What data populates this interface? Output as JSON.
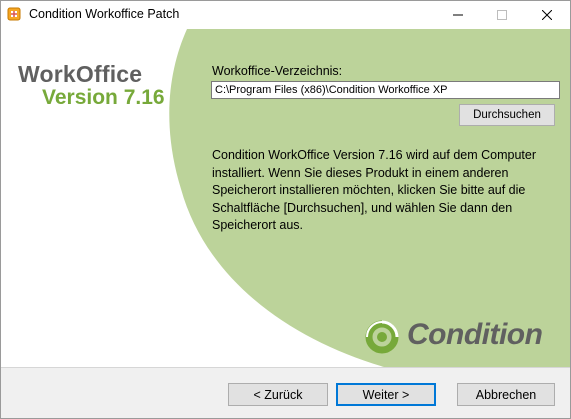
{
  "window": {
    "title": "Condition Workoffice Patch"
  },
  "brand": {
    "name": "WorkOffice",
    "version": "Version 7.16",
    "logo_text": "Condition"
  },
  "directory": {
    "label": "Workoffice-Verzeichnis:",
    "value": "C:\\Program Files (x86)\\Condition Workoffice XP",
    "browse_label": "Durchsuchen"
  },
  "info_text": "Condition WorkOffice Version 7.16 wird auf dem Computer installiert. Wenn Sie dieses Produkt in einem anderen Speicherort installieren möchten, klicken Sie bitte auf die Schaltfläche [Durchsuchen], und wählen Sie dann den Speicherort aus.",
  "footer": {
    "back_label": "< Zurück",
    "next_label": "Weiter >",
    "cancel_label": "Abbrechen"
  },
  "colors": {
    "accent_green": "#77a93a",
    "panel_green": "#bcd39a",
    "focus_blue": "#0078d7"
  }
}
